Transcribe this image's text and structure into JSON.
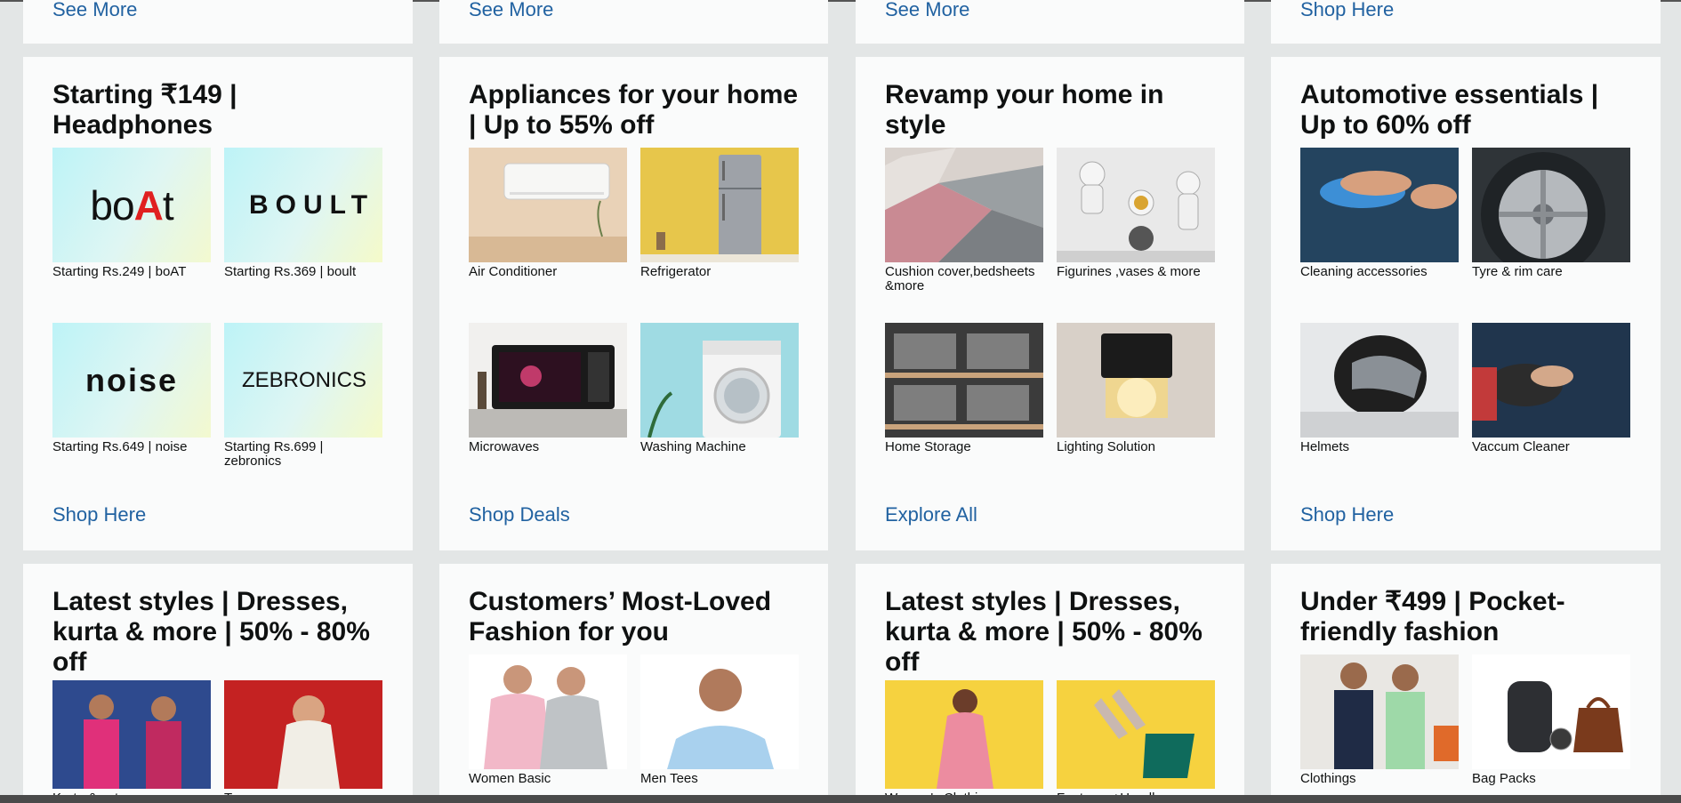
{
  "top_row": [
    {
      "link": "See More"
    },
    {
      "link": "See More"
    },
    {
      "link": "See More"
    },
    {
      "link": "Shop Here"
    }
  ],
  "cards": [
    {
      "title": "Starting ₹149 | Headphones",
      "link": "Shop Here",
      "tiles": [
        {
          "label": "Starting Rs.249 | boAT",
          "icon": "boat-logo",
          "logo_text": "boAt"
        },
        {
          "label": "Starting Rs.369 | boult",
          "icon": "boult-logo",
          "logo_text": "BOULT"
        },
        {
          "label": "Starting Rs.649 | noise",
          "icon": "noise-logo",
          "logo_text": "noise"
        },
        {
          "label": "Starting Rs.699 | zebronics",
          "icon": "zebronics-logo",
          "logo_text": "ZEBRONICS"
        }
      ]
    },
    {
      "title": "Appliances for your home | Up to 55% off",
      "link": "Shop Deals",
      "tiles": [
        {
          "label": "Air Conditioner",
          "icon": "air-conditioner-image"
        },
        {
          "label": "Refrigerator",
          "icon": "refrigerator-image"
        },
        {
          "label": "Microwaves",
          "icon": "microwave-image"
        },
        {
          "label": "Washing Machine",
          "icon": "washing-machine-image"
        }
      ]
    },
    {
      "title": "Revamp your home in style",
      "link": "Explore All",
      "tiles": [
        {
          "label": "Cushion cover,bedsheets &more",
          "icon": "rug-image"
        },
        {
          "label": "Figurines ,vases & more",
          "icon": "astronaut-figurines-image"
        },
        {
          "label": "Home Storage",
          "icon": "storage-shelf-image"
        },
        {
          "label": "Lighting Solution",
          "icon": "wall-lamp-image"
        }
      ]
    },
    {
      "title": "Automotive essentials | Up to 60% off",
      "link": "Shop Here",
      "tiles": [
        {
          "label": "Cleaning accessories",
          "icon": "car-cleaning-image"
        },
        {
          "label": "Tyre & rim care",
          "icon": "tyre-rim-image"
        },
        {
          "label": "Helmets",
          "icon": "helmet-image"
        },
        {
          "label": "Vaccum Cleaner",
          "icon": "vacuum-cleaner-image"
        }
      ]
    }
  ],
  "bottom_cards": [
    {
      "title": "Latest styles | Dresses, kurta & more | 50% - 80% off",
      "tiles": [
        {
          "label": "Kurta & set",
          "icon": "kurta-set-image"
        },
        {
          "label": "Tops",
          "icon": "tops-image"
        }
      ]
    },
    {
      "title": "Customers’ Most-Loved Fashion for you",
      "tiles": [
        {
          "label": "Women Basic",
          "icon": "women-basic-image"
        },
        {
          "label": "Men Tees",
          "icon": "men-tees-image"
        }
      ]
    },
    {
      "title": "Latest styles | Dresses, kurta & more | 50% - 80% off",
      "tiles": [
        {
          "label": "Women's Clothing",
          "icon": "womens-clothing-image"
        },
        {
          "label": "Footwear+Handbags",
          "icon": "footwear-handbags-image"
        }
      ]
    },
    {
      "title": "Under ₹499 | Pocket-friendly fashion",
      "tiles": [
        {
          "label": "Clothings",
          "icon": "clothings-image"
        },
        {
          "label": "Bag Packs",
          "icon": "bag-packs-image"
        }
      ]
    }
  ],
  "colors": {
    "link": "#2162a1",
    "card_bg": "#fafbfb",
    "page_bg": "#e3e6e6"
  }
}
